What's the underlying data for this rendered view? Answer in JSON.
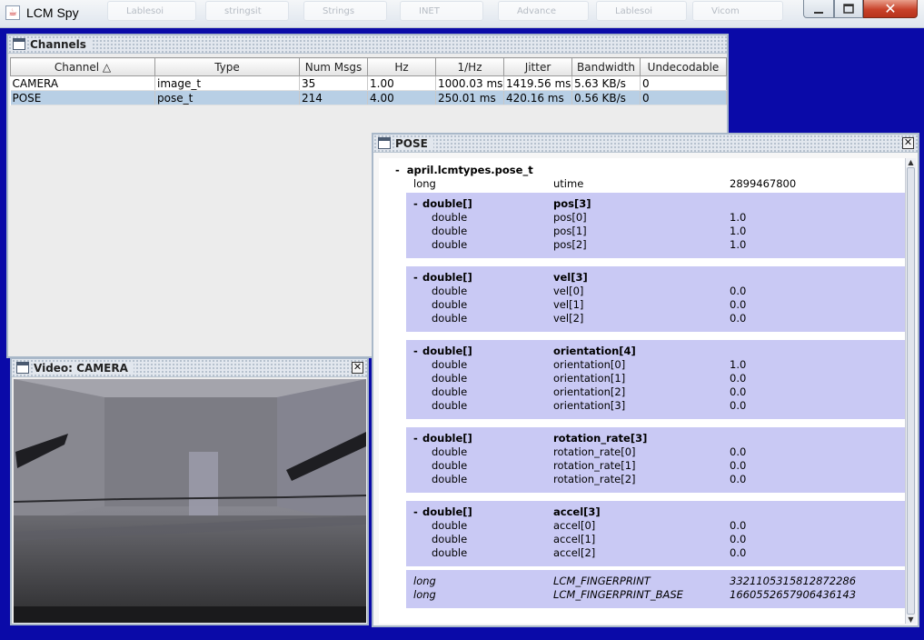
{
  "window": {
    "title": "LCM Spy",
    "bg_tabs": [
      "Lablesoi",
      "stringsit",
      "Strings",
      "INET",
      "Advance",
      "Lablesoi",
      "Vicom"
    ],
    "colors": {
      "desktop": "#0a0aa8",
      "selection": "#b8cfe5",
      "group": "#c9c9f4"
    }
  },
  "channels": {
    "title": "Channels",
    "columns": [
      "Channel △",
      "Type",
      "Num Msgs",
      "Hz",
      "1/Hz",
      "Jitter",
      "Bandwidth",
      "Undecodable"
    ],
    "rows": [
      [
        "CAMERA",
        "image_t",
        "35",
        "1.00",
        "1000.03 ms",
        "1419.56 ms",
        "5.63 KB/s",
        "0"
      ],
      [
        "POSE",
        "pose_t",
        "214",
        "4.00",
        "250.01 ms",
        "420.16 ms",
        "0.56 KB/s",
        "0"
      ]
    ]
  },
  "video": {
    "title": "Video: CAMERA"
  },
  "pose": {
    "title": "POSE",
    "root_label": "april.lcmtypes.pose_t",
    "collapse_glyph": "-",
    "utime": {
      "type": "long",
      "name": "utime",
      "value": "2899467800"
    },
    "groups": [
      {
        "type": "double[]",
        "name": "pos[3]",
        "items": [
          {
            "type": "double",
            "name": "pos[0]",
            "value": "1.0"
          },
          {
            "type": "double",
            "name": "pos[1]",
            "value": "1.0"
          },
          {
            "type": "double",
            "name": "pos[2]",
            "value": "1.0"
          }
        ]
      },
      {
        "type": "double[]",
        "name": "vel[3]",
        "items": [
          {
            "type": "double",
            "name": "vel[0]",
            "value": "0.0"
          },
          {
            "type": "double",
            "name": "vel[1]",
            "value": "0.0"
          },
          {
            "type": "double",
            "name": "vel[2]",
            "value": "0.0"
          }
        ]
      },
      {
        "type": "double[]",
        "name": "orientation[4]",
        "items": [
          {
            "type": "double",
            "name": "orientation[0]",
            "value": "1.0"
          },
          {
            "type": "double",
            "name": "orientation[1]",
            "value": "0.0"
          },
          {
            "type": "double",
            "name": "orientation[2]",
            "value": "0.0"
          },
          {
            "type": "double",
            "name": "orientation[3]",
            "value": "0.0"
          }
        ]
      },
      {
        "type": "double[]",
        "name": "rotation_rate[3]",
        "items": [
          {
            "type": "double",
            "name": "rotation_rate[0]",
            "value": "0.0"
          },
          {
            "type": "double",
            "name": "rotation_rate[1]",
            "value": "0.0"
          },
          {
            "type": "double",
            "name": "rotation_rate[2]",
            "value": "0.0"
          }
        ]
      },
      {
        "type": "double[]",
        "name": "accel[3]",
        "items": [
          {
            "type": "double",
            "name": "accel[0]",
            "value": "0.0"
          },
          {
            "type": "double",
            "name": "accel[1]",
            "value": "0.0"
          },
          {
            "type": "double",
            "name": "accel[2]",
            "value": "0.0"
          }
        ]
      }
    ],
    "footer": [
      {
        "type": "long",
        "name": "LCM_FINGERPRINT",
        "value": "3321105315812872286"
      },
      {
        "type": "long",
        "name": "LCM_FINGERPRINT_BASE",
        "value": "1660552657906436143"
      }
    ]
  }
}
